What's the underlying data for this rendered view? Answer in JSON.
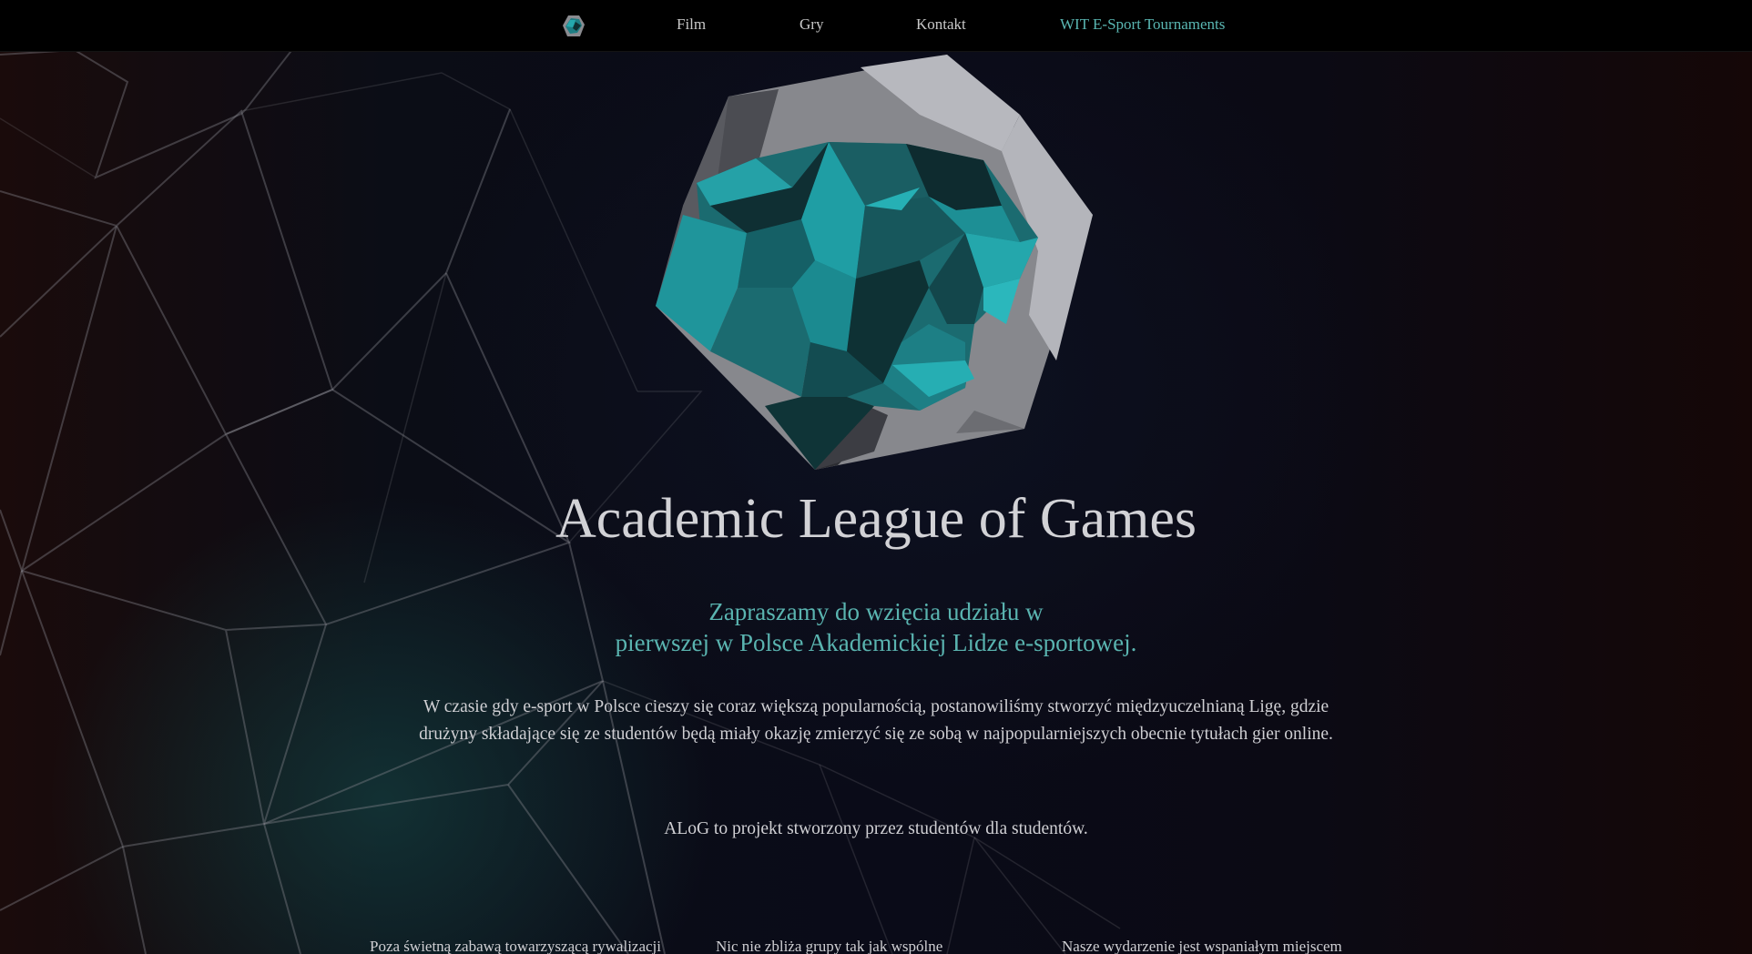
{
  "nav": {
    "logo_icon": "alog-panther-logo-icon",
    "links": [
      "Film",
      "Gry",
      "Kontakt",
      "WIT E-Sport Tournaments"
    ]
  },
  "hero": {
    "logo_icon": "panther-head-logo-icon",
    "title": "Academic League of Games",
    "subtitle_line1": "Zapraszamy do wzięcia udziału w",
    "subtitle_line2": "pierwszej w Polsce Akademickiej Lidze e-sportowej.",
    "paragraph": "W czasie gdy e-sport w Polsce cieszy się coraz większą popularnością, postanowiliśmy stworzyć międzyuczelnianą Ligę, gdzie drużyny składające się ze studentów będą miały okazję zmierzyć się ze sobą w najpopularniejszych obecnie tytułach gier online.",
    "tagline": "ALoG to projekt stworzony przez studentów dla studentów."
  },
  "columns": [
    "Poza świetną zabawą towarzyszącą rywalizacji",
    "Nic nie zbliża grupy tak jak wspólne",
    "Nasze wydarzenie jest wspaniałym miejscem"
  ],
  "colors": {
    "accent": "#5ab7b3",
    "nav_background": "#000000",
    "text": "#cfcfd3",
    "title": "#d2d2d6",
    "teal_light": "#24a9ad",
    "teal_mid": "#1b7278",
    "teal_dark": "#0e2a2e",
    "hex_light": "#b7b7bd",
    "hex_mid": "#87888d",
    "hex_dark": "#3b3c42"
  }
}
